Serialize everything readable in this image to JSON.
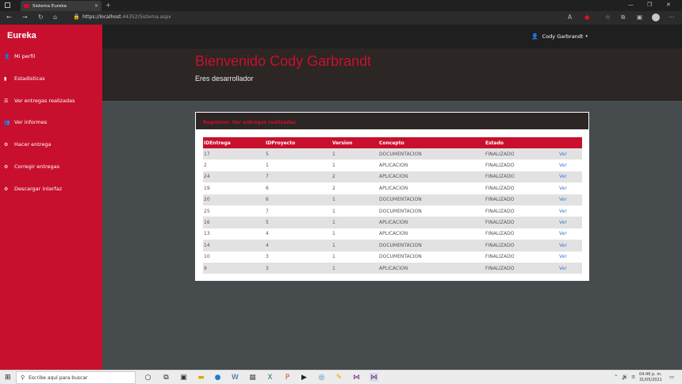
{
  "browser": {
    "tab_title": "Sistema Eureka",
    "tab_close": "×",
    "new_tab": "+",
    "url_host": "https://localhost",
    "url_rest": ":44352/Sistema.aspx"
  },
  "app": {
    "brand": "Eureka",
    "user_name": "Cody Garbrandt",
    "caret": "▾",
    "welcome": "Bienvenido Cody Garbrandt",
    "role": "Eres desarrollador"
  },
  "sidebar": {
    "items": [
      {
        "label": "Mi perfil",
        "icon": "👤"
      },
      {
        "label": "Estadisticas",
        "icon": "▮"
      },
      {
        "label": "Ver entregas realizadas",
        "icon": "☰"
      },
      {
        "label": "Ver informes",
        "icon": "👥"
      },
      {
        "label": "Hacer entrega",
        "icon": "⚙"
      },
      {
        "label": "Corregir entregas",
        "icon": "⚙"
      },
      {
        "label": "Descargar interfaz",
        "icon": "⚙"
      }
    ]
  },
  "panel": {
    "title": "Registros: Ver entregas realizadas"
  },
  "table": {
    "headers": [
      "IDEntrega",
      "IDProyecto",
      "Version",
      "Concepto",
      "Estado",
      ""
    ],
    "rows": [
      [
        "17",
        "5",
        "1",
        "DOCUMENTACION",
        "FINALIZADO",
        "Ver"
      ],
      [
        "2",
        "1",
        "1",
        "APLICACION",
        "FINALIZADO",
        "Ver"
      ],
      [
        "24",
        "7",
        "2",
        "APLICACION",
        "FINALIZADO",
        "Ver"
      ],
      [
        "19",
        "6",
        "2",
        "APLICACION",
        "FINALIZADO",
        "Ver"
      ],
      [
        "20",
        "6",
        "1",
        "DOCUMENTACION",
        "FINALIZADO",
        "Ver"
      ],
      [
        "25",
        "7",
        "1",
        "DOCUMENTACION",
        "FINALIZADO",
        "Ver"
      ],
      [
        "16",
        "5",
        "1",
        "APLICACION",
        "FINALIZADO",
        "Ver"
      ],
      [
        "13",
        "4",
        "1",
        "APLICACION",
        "FINALIZADO",
        "Ver"
      ],
      [
        "14",
        "4",
        "1",
        "DOCUMENTACION",
        "FINALIZADO",
        "Ver"
      ],
      [
        "10",
        "3",
        "1",
        "DOCUMENTACION",
        "FINALIZADO",
        "Ver"
      ],
      [
        "9",
        "3",
        "1",
        "APLICACION",
        "FINALIZADO",
        "Ver"
      ]
    ]
  },
  "taskbar": {
    "search_placeholder": "Escribe aquí para buscar",
    "time": "04:46 p. m.",
    "date": "31/05/2021"
  },
  "colors": {
    "accent": "#c8102e",
    "dark": "#2c2624",
    "content_bg": "#464b4e",
    "link": "#3a7bd5"
  }
}
